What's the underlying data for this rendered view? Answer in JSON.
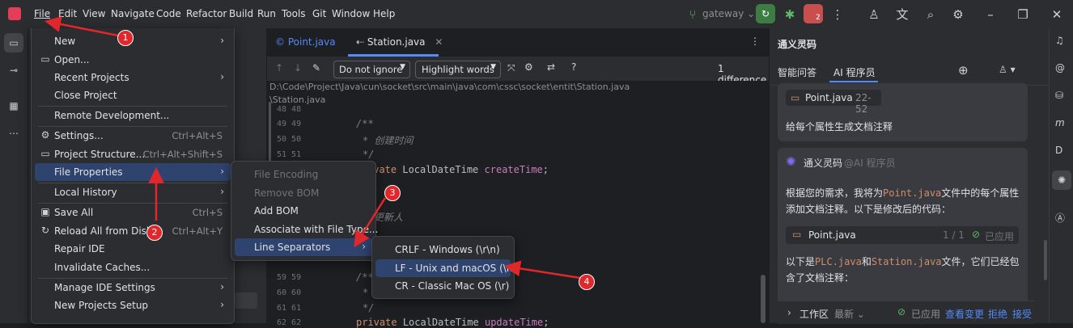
{
  "menubar": [
    "File",
    "Edit",
    "View",
    "Navigate",
    "Code",
    "Refactor",
    "Build",
    "Run",
    "Tools",
    "Git",
    "Window",
    "Help"
  ],
  "toolbar": {
    "branch": "gateway",
    "run_badge": "2"
  },
  "editor": {
    "tabs": [
      {
        "label": "Point.java",
        "active": false
      },
      {
        "label": "Station.java",
        "active": true
      }
    ],
    "diff": {
      "ignore_select": "Do not ignore",
      "highlight_select": "Highlight words",
      "difference_count": "1 difference"
    },
    "path_line1": "D:\\Code\\Project\\Java\\cun\\socket\\src\\main\\java\\com\\cssc\\socket\\entit\\Station.java",
    "path_line2": "\\Station.java",
    "gutter": [
      "48 48",
      "49 49",
      "50 50",
      "51 51",
      "",
      "",
      "",
      "",
      "",
      "59 59",
      "60 60",
      "61 61",
      "62 62"
    ],
    "code": {
      "line1": "/**",
      "line2": "* 创建时间",
      "line3": "*/",
      "line4_kw": "ivate",
      "line4_type": "LocalDateTime",
      "line4_field": "createTime",
      "line5": "更新人",
      "line6": "/**",
      "line7": "*",
      "line8": "*/",
      "line9_kw": "private",
      "line9_type": "LocalDateTime",
      "line9_field": "updateTime"
    }
  },
  "file_menu": {
    "items": [
      {
        "label": "New",
        "has_submenu": true
      },
      {
        "label": "Open...",
        "icon": "folder-icon"
      },
      {
        "label": "Recent Projects",
        "has_submenu": true
      },
      {
        "label": "Close Project"
      },
      {
        "label": "Remote Development..."
      },
      {
        "label": "Settings...",
        "icon": "gear-icon",
        "shortcut": "Ctrl+Alt+S"
      },
      {
        "label": "Project Structure...",
        "icon": "folder-icon",
        "shortcut": "Ctrl+Alt+Shift+S"
      },
      {
        "label": "File Properties",
        "has_submenu": true,
        "selected": true
      },
      {
        "label": "Local History",
        "has_submenu": true
      },
      {
        "label": "Save All",
        "icon": "save-icon",
        "shortcut": "Ctrl+S"
      },
      {
        "label": "Reload All from Disk",
        "icon": "reload-icon",
        "shortcut": "Ctrl+Alt+Y"
      },
      {
        "label": "Repair IDE"
      },
      {
        "label": "Invalidate Caches..."
      },
      {
        "label": "Manage IDE Settings",
        "has_submenu": true
      },
      {
        "label": "New Projects Setup",
        "has_submenu": true
      }
    ]
  },
  "file_properties_menu": {
    "items": [
      {
        "label": "File Encoding",
        "disabled": true
      },
      {
        "label": "Remove BOM",
        "disabled": true
      },
      {
        "label": "Add BOM"
      },
      {
        "label": "Associate with File Type..."
      },
      {
        "label": "Line Separators",
        "has_submenu": true,
        "selected": true
      }
    ]
  },
  "line_separators_menu": {
    "items": [
      {
        "label": "CRLF - Windows (\\r\\n)"
      },
      {
        "label": "LF - Unix and macOS (\\n)",
        "selected": true
      },
      {
        "label": "CR - Classic Mac OS (\\r)"
      }
    ]
  },
  "annotations": [
    "1",
    "2",
    "3",
    "4"
  ],
  "ai_panel": {
    "title": "通义灵码",
    "tabs": [
      "智能问答",
      "AI 程序员"
    ],
    "ref_file": "Point.java",
    "ref_range": "22-52",
    "user_msg": "给每个属性生成文档注释",
    "bot_name": "通义灵码",
    "bot_role": "@AI 程序员",
    "reply_part1": "根据您的需求，我将为",
    "reply_code1": "Point.java",
    "reply_part2": "文件中的每个属性添加文档注释。以下是修改后的代码：",
    "file_card": {
      "name": "Point.java",
      "count": "1 / 1",
      "status": "已应用"
    },
    "reply2_part1": "以下是",
    "reply2_code1": "PLC.java",
    "reply2_mid": "和",
    "reply2_code2": "Station.java",
    "reply2_part2": "文件，它们已经包含了文档注释：",
    "footer": {
      "workspace": "工作区",
      "latest": "最新",
      "applied": "已应用",
      "view": "查看变更",
      "reject": "拒绝",
      "accept": "接受"
    }
  },
  "colors": {
    "accent": "#2e436e",
    "annotation_red": "#e0282c",
    "link_blue": "#548af7",
    "applied_green": "#5fb865"
  }
}
